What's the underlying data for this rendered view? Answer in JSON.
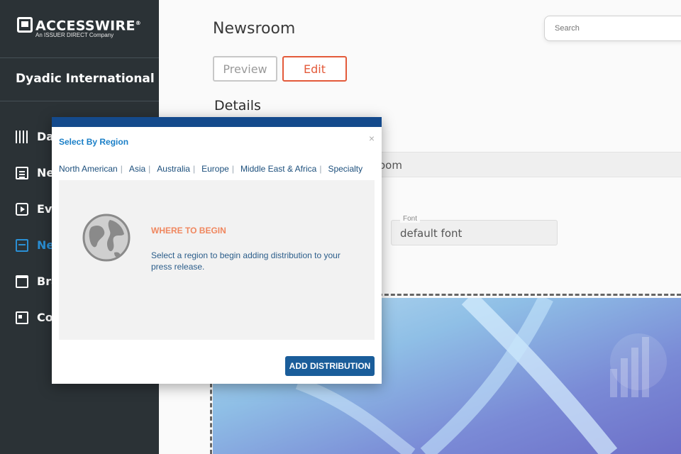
{
  "brand": {
    "name": "ACCESSWIRE",
    "registered": "®",
    "tagline": "An ISSUER DIRECT Company"
  },
  "sidebar": {
    "company": "Dyadic International Inc",
    "items": [
      {
        "label": "Da",
        "icon": "dashboard-bars-icon"
      },
      {
        "label": "Ne",
        "icon": "document-icon"
      },
      {
        "label": "Eve",
        "icon": "play-icon"
      },
      {
        "label": "Ne",
        "icon": "calendar-icon",
        "active": true
      },
      {
        "label": "Bra",
        "icon": "folder-icon"
      },
      {
        "label": "Co",
        "icon": "contact-card-icon"
      }
    ]
  },
  "main": {
    "title": "Newsroom",
    "search_placeholder": "Search",
    "preview_label": "Preview",
    "edit_label": "Edit",
    "details_heading": "Details",
    "bar_text": "oom",
    "font_label": "Font",
    "font_value": "default font"
  },
  "modal": {
    "title": "Select By Region",
    "close": "×",
    "regions": [
      "North American",
      "Asia",
      "Australia",
      "Europe",
      "Middle East & Africa",
      "Specialty"
    ],
    "separator": "|",
    "heading": "WHERE TO BEGIN",
    "description": "Select a region to begin adding distribution to your press release.",
    "button_label": "ADD DISTRIBUTION"
  },
  "colors": {
    "sidebar_bg": "#2b3236",
    "active_nav": "#2a8fd4",
    "edit_accent": "#e35a3a",
    "modal_header": "#144a8c",
    "modal_title": "#1a7fc7",
    "heading_orange": "#f0875f",
    "button_blue": "#1a5d9a"
  }
}
